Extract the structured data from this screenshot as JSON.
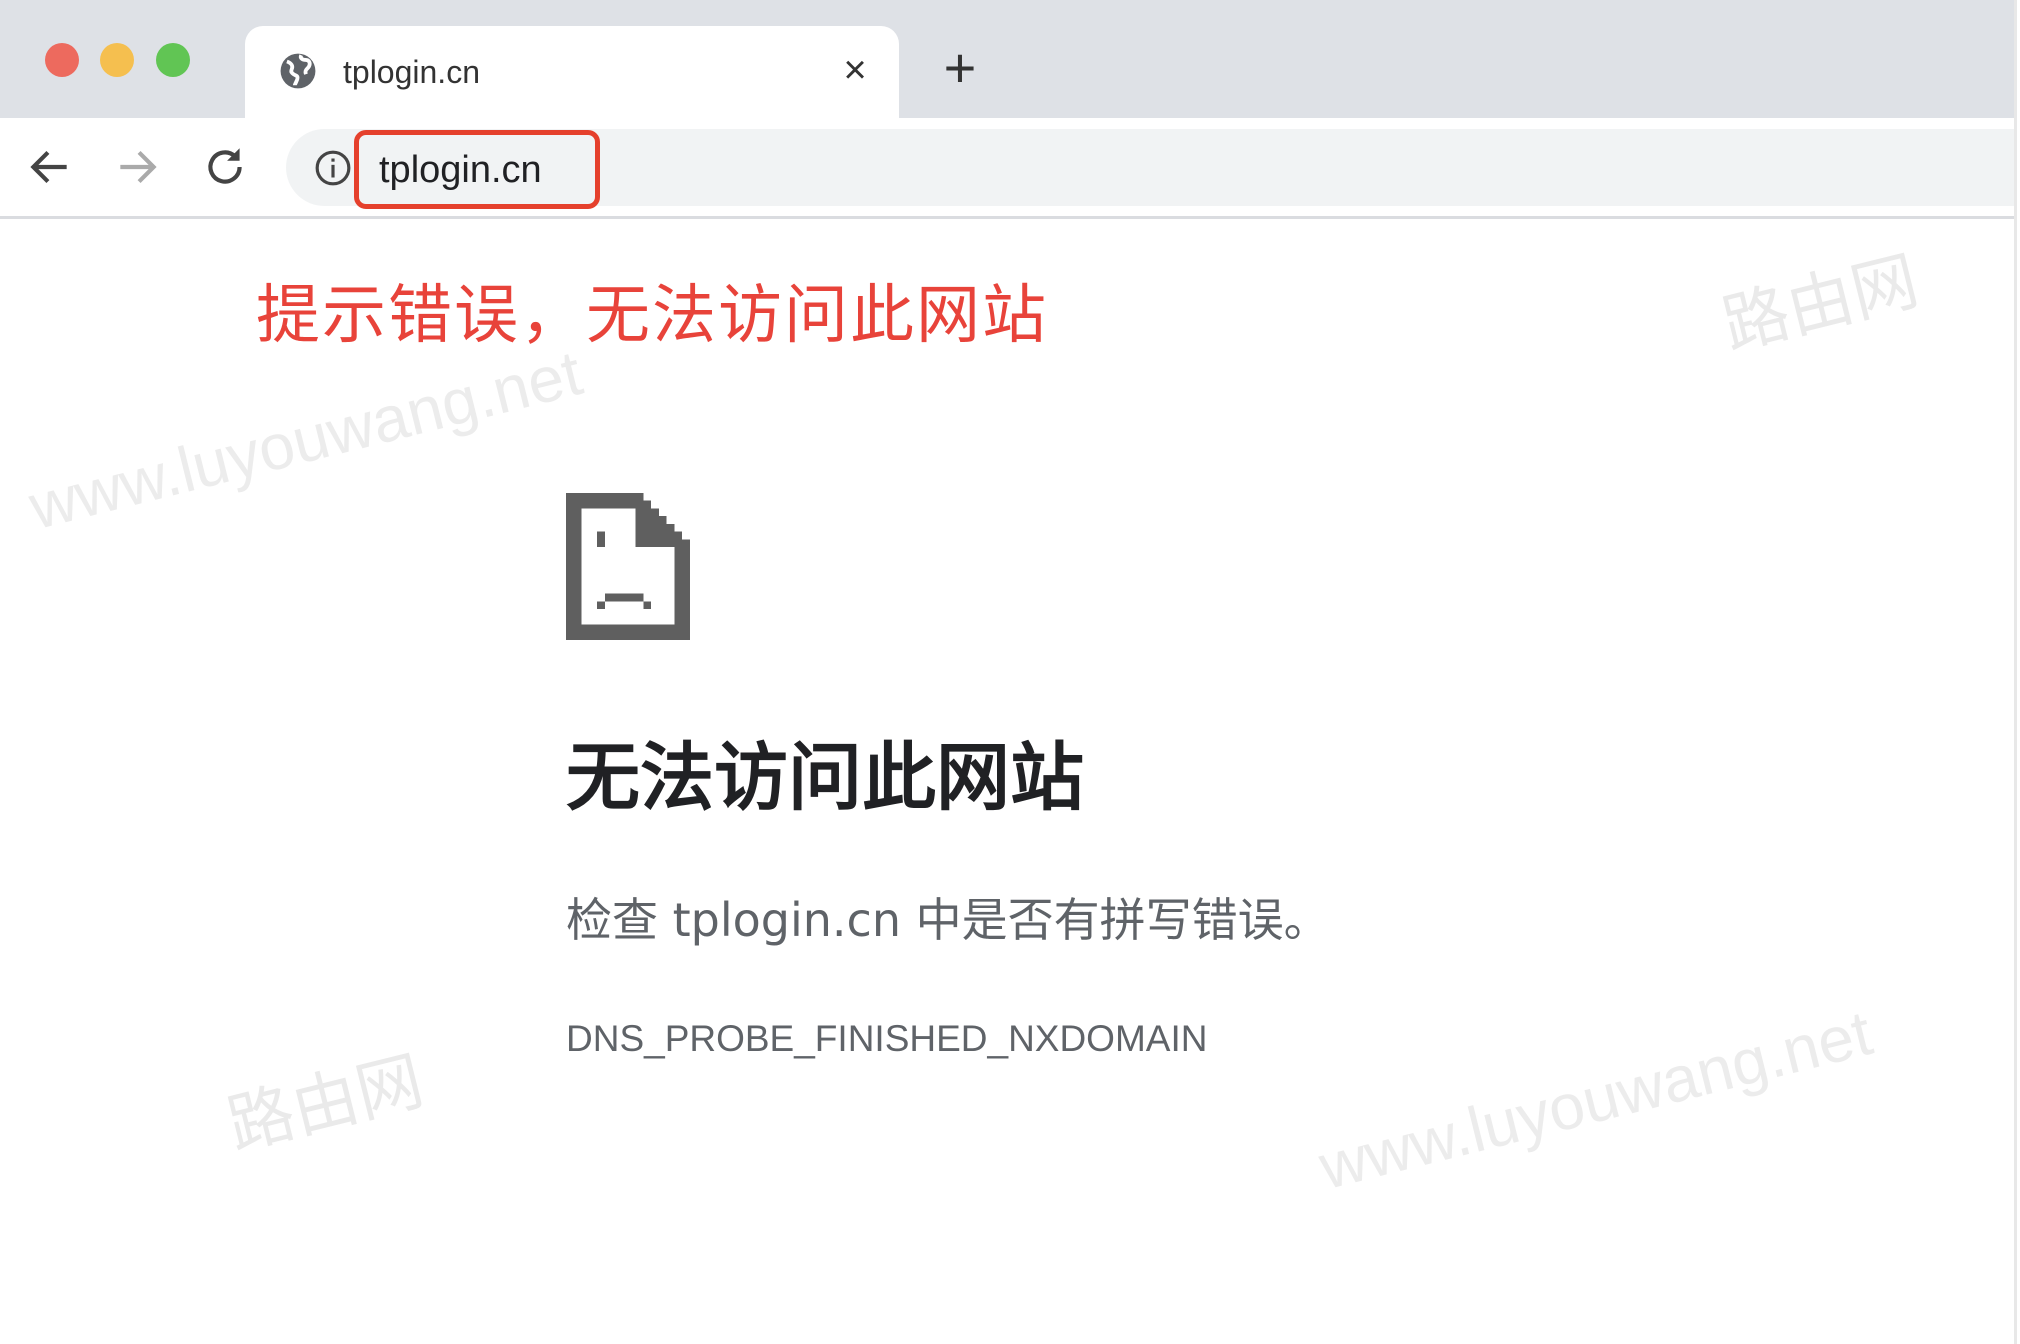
{
  "window": {
    "controls": {
      "close_color": "#ed6a5e",
      "minimize_color": "#f5bf4f",
      "maximize_color": "#61c554"
    }
  },
  "tab": {
    "title": "tplogin.cn",
    "close_glyph": "×",
    "new_tab_glyph": "+"
  },
  "toolbar": {
    "url": "tplogin.cn",
    "highlight_color": "#e5402c"
  },
  "annotation": {
    "text": "提示错误，无法访问此网站",
    "color": "#e8433a"
  },
  "error_page": {
    "heading": "无法访问此网站",
    "description": "检查 tplogin.cn 中是否有拼写错误。",
    "error_code": "DNS_PROBE_FINISHED_NXDOMAIN"
  },
  "watermarks": {
    "site": "www.luyouwang.net",
    "brand": "路由网"
  }
}
